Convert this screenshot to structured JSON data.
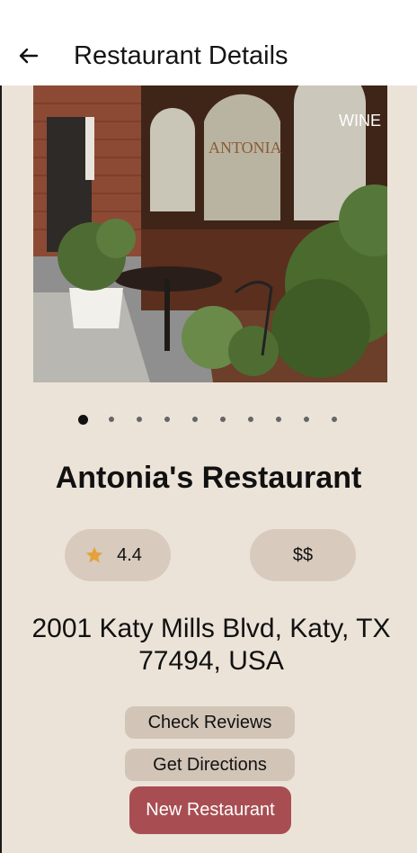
{
  "header": {
    "title": "Restaurant Details",
    "back_icon": "arrow-left-icon"
  },
  "gallery": {
    "image_description_icon": "restaurant-patio-photo",
    "total_images": 10,
    "active_index": 0
  },
  "restaurant": {
    "name": "Antonia's Restaurant",
    "rating": "4.4",
    "rating_icon": "star-icon",
    "price_level": "$$",
    "address": "2001 Katy Mills Blvd, Katy, TX 77494, USA"
  },
  "actions": {
    "check_reviews_label": "Check Reviews",
    "get_directions_label": "Get Directions",
    "new_restaurant_label": "New Restaurant"
  },
  "colors": {
    "background": "#ece3d8",
    "pill": "#d8cabd",
    "secondary_button": "#d2c5b8",
    "primary_button": "#a84e52",
    "star": "#e3a33a"
  }
}
